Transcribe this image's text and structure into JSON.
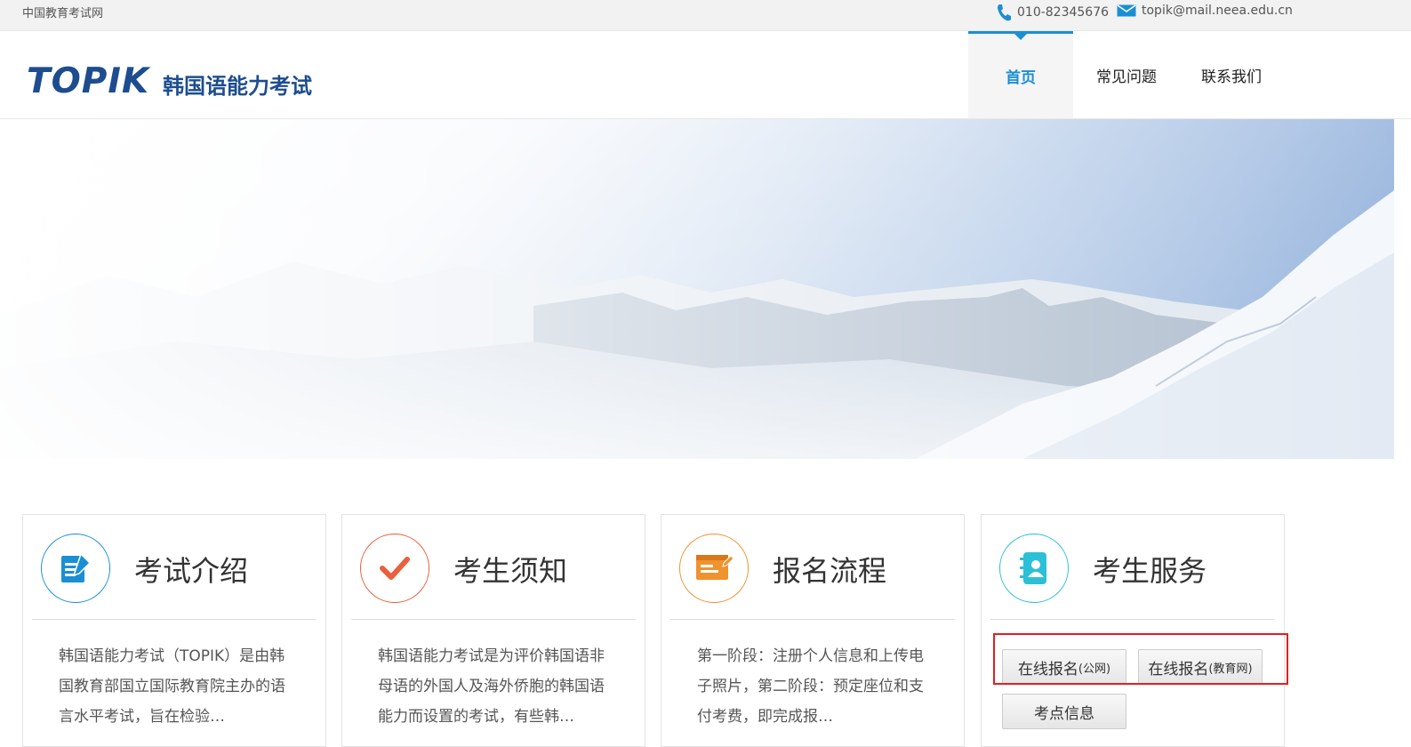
{
  "topbar": {
    "site_name": "中国教育考试网",
    "phone": "010-82345676",
    "email": "topik@mail.neea.edu.cn"
  },
  "header": {
    "logo_en": "TOPIK",
    "logo_cn": "韩国语能力考试",
    "nav": [
      {
        "label": "首页",
        "active": true
      },
      {
        "label": "常见问题",
        "active": false
      },
      {
        "label": "联系我们",
        "active": false
      }
    ]
  },
  "cards": [
    {
      "title": "考试介绍",
      "desc": "韩国语能力考试（TOPIK）是由韩国教育部国立国际教育院主办的语言水平考试，旨在检验…",
      "icon": "document-pen-icon",
      "color": "#1a8fd3"
    },
    {
      "title": "考生须知",
      "desc": "韩国语能力考试是为评价韩国语非母语的外国人及海外侨胞的韩国语能力而设置的考试，有些韩…",
      "icon": "check-icon",
      "color": "#e8603c"
    },
    {
      "title": "报名流程",
      "desc": "第一阶段：注册个人信息和上传电子照片，第二阶段：预定座位和支付考费，即完成报…",
      "icon": "form-edit-icon",
      "color": "#f0922e"
    },
    {
      "title": "考生服务",
      "icon": "contact-book-icon",
      "color": "#2cc0d8"
    }
  ],
  "services": {
    "btn_public_main": "在线报名",
    "btn_public_sub": "(公网)",
    "btn_edu_main": "在线报名",
    "btn_edu_sub": "(教育网)",
    "btn_venue": "考点信息"
  }
}
